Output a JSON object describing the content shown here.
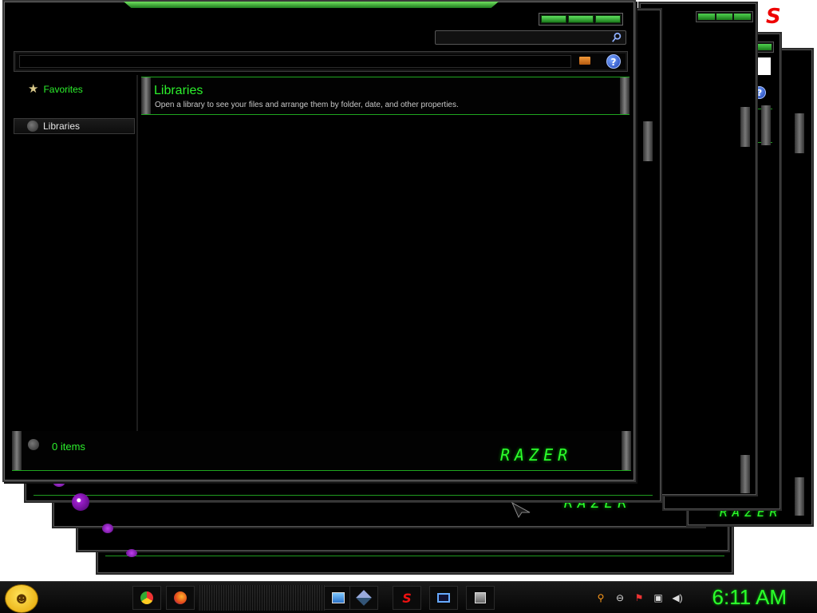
{
  "window": {
    "title": "Libraries",
    "breadcrumb": ""
  },
  "search": {
    "placeholder": ""
  },
  "nav": {
    "favorites_label": "Favorites",
    "libraries_label": "Libraries"
  },
  "content": {
    "header_title": "Libraries",
    "header_description": "Open a library to see your files and arrange them by folder, date, and other properties."
  },
  "details": {
    "item_count": "0 items"
  },
  "branding": {
    "logo_text": "RAZER"
  },
  "taskbar": {
    "clock": "6:11 AM",
    "apps": [
      "chrome-icon",
      "firefox-icon",
      "control-panel-icon",
      "virtualbox-icon",
      "s-app-icon",
      "window-app-icon",
      "network-app-icon"
    ]
  },
  "colors": {
    "accent": "#2cf02c",
    "background": "#000000"
  }
}
